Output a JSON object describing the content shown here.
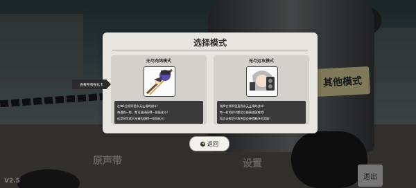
{
  "modal": {
    "title": "选择模式",
    "modes": [
      {
        "title": "无尽肉鸽模式",
        "description": [
          "在每1位领军里永无止境的战斗!",
          "每通终一轮，都可选择获得一张强化卡!",
          "这是领军蓝它永被的获得一张强化卡!"
        ]
      },
      {
        "title": "无尽运攻模式",
        "description": [
          "指挥它领军里直到永无止境的战斗!",
          "每一轮的防守都比以前更加困难的!",
          "每次击败防守角色都会获得额外的奖励!"
        ]
      }
    ],
    "view_all_label": "查看所有强化卡",
    "back_label": "返回"
  },
  "background": {
    "side_sign": "其他模式",
    "floor_labels": [
      "原声带",
      "设置"
    ],
    "quit_label": "退出",
    "version": "V2.5"
  }
}
